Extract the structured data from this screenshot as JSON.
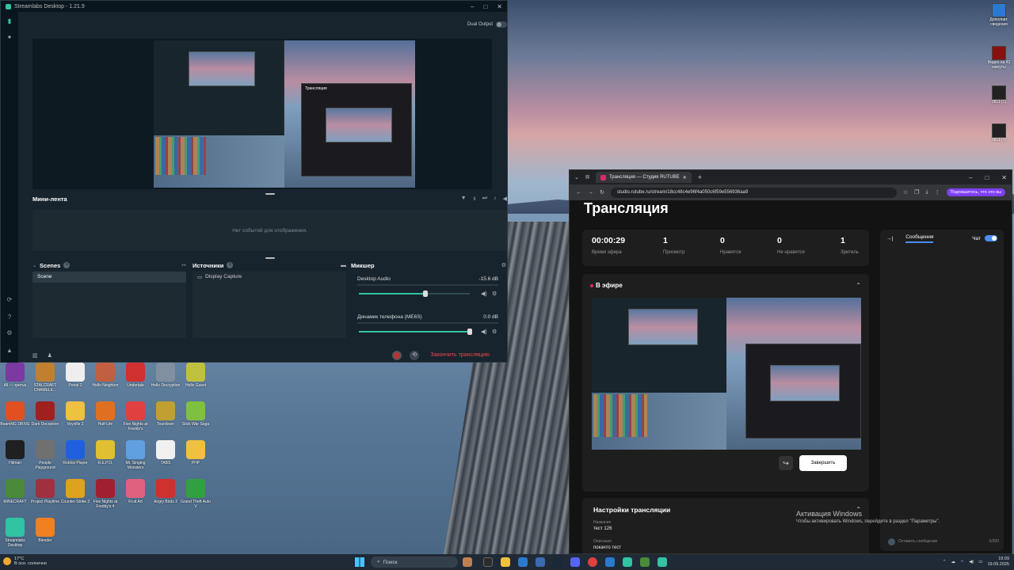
{
  "slobs": {
    "title": "Streamlabs Desktop - 1.21.9",
    "dual_output_label": "Dual Output",
    "minifeed": {
      "title": "Мини-лента",
      "empty_text": "Нет событий для отображения."
    },
    "scenes": {
      "title": "Scenes",
      "items": [
        "Scene"
      ]
    },
    "sources": {
      "title": "Источники",
      "items": [
        "Display Capture"
      ]
    },
    "mixer": {
      "title": "Микшер",
      "tracks": [
        {
          "name": "Desktop Audio",
          "db": "-15.6 dB",
          "volume": 0.6
        },
        {
          "name": "Динамик телефона (ME6S)",
          "db": "0.0 dB",
          "volume": 1.0
        }
      ]
    },
    "end_stream_label": "Закончить трансляцию",
    "preview_inner_title": "Трансляция"
  },
  "browser": {
    "tab_title": "Трансляция — Студия RUTUBE",
    "url": "studio.rutube.ru/stream/18cc48c4e96f4a050c6f59e556936aa9",
    "ext_button": "Подпишитесь, что это вы",
    "page_title": "Трансляция",
    "stats": [
      {
        "value": "00:00:29",
        "label": "Время эфира"
      },
      {
        "value": "1",
        "label": "Просмотр"
      },
      {
        "value": "0",
        "label": "Нравится"
      },
      {
        "value": "0",
        "label": "Не нравится"
      },
      {
        "value": "1",
        "label": "Зритель"
      }
    ],
    "live_label": "В эфире",
    "finish_button": "Завершить",
    "settings": {
      "title": "Настройки трансляции",
      "name_label": "Название",
      "name_value": "тест 126",
      "desc_label": "Описание",
      "desc_value": "покачто тест"
    },
    "chat": {
      "messages_tab": "Сообщения",
      "chat_label": "Чат",
      "input_placeholder": "Оставить сообщение",
      "counter": "0/200"
    }
  },
  "desktop_icons": [
    {
      "label": "All — третье",
      "color": "#7a3aa0"
    },
    {
      "label": "STALCRAFT CHAMELE...",
      "color": "#c08030"
    },
    {
      "label": "Portal 2",
      "color": "#eee"
    },
    {
      "label": "Hello Neighbor",
      "color": "#c06040"
    },
    {
      "label": "Undertale",
      "color": "#d03030"
    },
    {
      "label": "Hello Decryption",
      "color": "#8090a0"
    },
    {
      "label": "Hello Guest",
      "color": "#c0c040"
    },
    {
      "label": "BeamNG DRIVE",
      "color": "#e05020"
    },
    {
      "label": "Dark Deception",
      "color": "#a02020"
    },
    {
      "label": "Voyville 2",
      "color": "#f0c040"
    },
    {
      "label": "Half-Life",
      "color": "#e07020"
    },
    {
      "label": "Five Nights at Freddy's",
      "color": "#e04040"
    },
    {
      "label": "Teardown",
      "color": "#c0a030"
    },
    {
      "label": "Stick War Saga",
      "color": "#80c040"
    },
    {
      "label": "Hitman",
      "color": "#202020"
    },
    {
      "label": "People Playground",
      "color": "#707070"
    },
    {
      "label": "Roblox Player",
      "color": "#2060e0"
    },
    {
      "label": "R.E.P.O.",
      "color": "#e0c030"
    },
    {
      "label": "Mr. Singing Monsters",
      "color": "#60a0e0"
    },
    {
      "label": "TABS",
      "color": "#f0f0f0"
    },
    {
      "label": "PHP",
      "color": "#f0c040"
    },
    {
      "label": "MINECRAFT",
      "color": "#4a8a3a"
    },
    {
      "label": "Project Playtime",
      "color": "#a03040"
    },
    {
      "label": "Counter-Strike 2",
      "color": "#e0a020"
    },
    {
      "label": "Five Nights at Freddy's 4",
      "color": "#a02030"
    },
    {
      "label": "Fruit Art",
      "color": "#e06080"
    },
    {
      "label": "Angry Birds 2",
      "color": "#d03030"
    },
    {
      "label": "Grand Theft Auto V",
      "color": "#30a040"
    },
    {
      "label": "Streamlabs Desktop",
      "color": "#31c3a2"
    },
    {
      "label": "Blender",
      "color": "#f08020"
    }
  ],
  "right_icons": [
    {
      "label": "Дополнит. сведения"
    },
    {
      "label": "Видео на 42 минуты"
    },
    {
      "label": "0811 (1)"
    },
    {
      "label": "0811 (1)"
    }
  ],
  "activation": {
    "line1": "Активация Windows",
    "line2": "Чтобы активировать Windows, перейдите в раздел \"Параметры\"."
  },
  "taskbar": {
    "weather_temp": "17°C",
    "weather_desc": "В осн. солнечно",
    "search_placeholder": "Поиск",
    "time": "19:09",
    "date": "19.09.2025"
  }
}
